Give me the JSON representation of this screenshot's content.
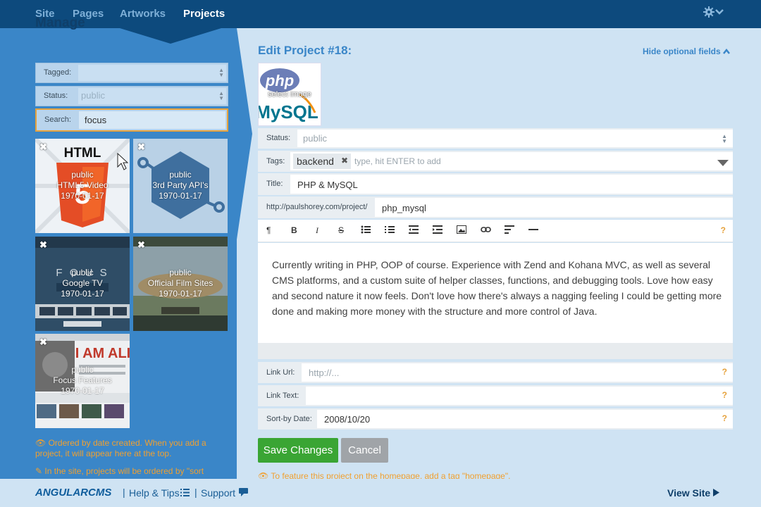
{
  "nav": {
    "items": [
      {
        "label": "Site"
      },
      {
        "label": "Pages"
      },
      {
        "label": "Artworks"
      },
      {
        "label": "Projects"
      }
    ]
  },
  "manage": {
    "title": "Manage",
    "filters": {
      "tagged_label": "Tagged:",
      "tagged_value": "",
      "status_label": "Status:",
      "status_value": "public",
      "search_label": "Search:",
      "search_value": "focus"
    },
    "tiles": [
      {
        "status": "public",
        "title": "HTML5 Video",
        "date": "1970-01-17"
      },
      {
        "status": "public",
        "title": "3rd Party API's",
        "date": "1970-01-17"
      },
      {
        "status": "public",
        "title": "Google TV",
        "date": "1970-01-17"
      },
      {
        "status": "public",
        "title": "Official Film Sites",
        "date": "1970-01-17"
      },
      {
        "status": "public",
        "title": "Focus Features",
        "date": "1970-01-17"
      }
    ],
    "tip1": "Ordered by date created. When you add a project, it will appear here at the top.",
    "tip2": "In the site, projects will be ordered by \"sort"
  },
  "edit": {
    "title": "Edit Project #18:",
    "hide_optional": "Hide optional fields",
    "image_select": "select image",
    "status_label": "Status:",
    "status_value": "public",
    "tags_label": "Tags:",
    "tag_chip": "backend",
    "tags_placeholder": "type, hit ENTER to add",
    "title_label": "Title:",
    "title_value": "PHP & MySQL",
    "url_prefix": "http://paulshorey.com/project/",
    "url_slug": "php_mysql",
    "body": "Currently writing in PHP, OOP of course. Experience with Zend and Kohana MVC, as well as several CMS platforms, and a custom suite of helper classes, functions, and debugging tools. Love how easy and second nature it now feels. Don't love how there's always a nagging feeling I could be getting more done and making more money with the structure and more control of Java.",
    "link_url_label": "Link Url:",
    "link_url_placeholder": "http://...",
    "link_text_label": "Link Text:",
    "link_text_value": "",
    "sort_label": "Sort-by Date:",
    "sort_value": "2008/10/20",
    "help_mark": "?",
    "save": "Save Changes",
    "cancel": "Cancel",
    "feature_tip": "To feature this project on the homepage, add a tag \"homepage\"."
  },
  "footer": {
    "logo": "ANGULARCMS",
    "help": "Help & Tips",
    "support": "Support",
    "view_site": "View Site"
  }
}
